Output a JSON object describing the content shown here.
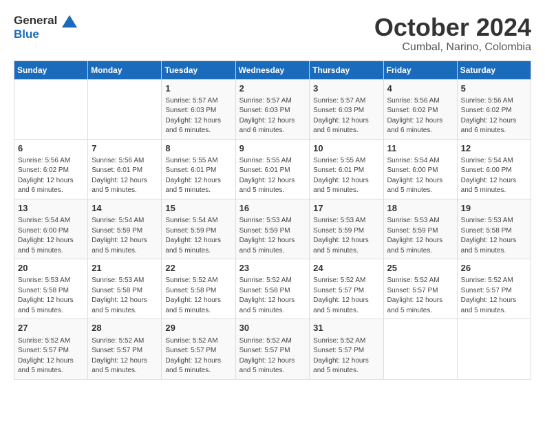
{
  "logo": {
    "line1": "General",
    "line2": "Blue"
  },
  "title": "October 2024",
  "subtitle": "Cumbal, Narino, Colombia",
  "headers": [
    "Sunday",
    "Monday",
    "Tuesday",
    "Wednesday",
    "Thursday",
    "Friday",
    "Saturday"
  ],
  "weeks": [
    [
      {
        "day": "",
        "sunrise": "",
        "sunset": "",
        "daylight": ""
      },
      {
        "day": "",
        "sunrise": "",
        "sunset": "",
        "daylight": ""
      },
      {
        "day": "1",
        "sunrise": "Sunrise: 5:57 AM",
        "sunset": "Sunset: 6:03 PM",
        "daylight": "Daylight: 12 hours and 6 minutes."
      },
      {
        "day": "2",
        "sunrise": "Sunrise: 5:57 AM",
        "sunset": "Sunset: 6:03 PM",
        "daylight": "Daylight: 12 hours and 6 minutes."
      },
      {
        "day": "3",
        "sunrise": "Sunrise: 5:57 AM",
        "sunset": "Sunset: 6:03 PM",
        "daylight": "Daylight: 12 hours and 6 minutes."
      },
      {
        "day": "4",
        "sunrise": "Sunrise: 5:56 AM",
        "sunset": "Sunset: 6:02 PM",
        "daylight": "Daylight: 12 hours and 6 minutes."
      },
      {
        "day": "5",
        "sunrise": "Sunrise: 5:56 AM",
        "sunset": "Sunset: 6:02 PM",
        "daylight": "Daylight: 12 hours and 6 minutes."
      }
    ],
    [
      {
        "day": "6",
        "sunrise": "Sunrise: 5:56 AM",
        "sunset": "Sunset: 6:02 PM",
        "daylight": "Daylight: 12 hours and 6 minutes."
      },
      {
        "day": "7",
        "sunrise": "Sunrise: 5:56 AM",
        "sunset": "Sunset: 6:01 PM",
        "daylight": "Daylight: 12 hours and 5 minutes."
      },
      {
        "day": "8",
        "sunrise": "Sunrise: 5:55 AM",
        "sunset": "Sunset: 6:01 PM",
        "daylight": "Daylight: 12 hours and 5 minutes."
      },
      {
        "day": "9",
        "sunrise": "Sunrise: 5:55 AM",
        "sunset": "Sunset: 6:01 PM",
        "daylight": "Daylight: 12 hours and 5 minutes."
      },
      {
        "day": "10",
        "sunrise": "Sunrise: 5:55 AM",
        "sunset": "Sunset: 6:01 PM",
        "daylight": "Daylight: 12 hours and 5 minutes."
      },
      {
        "day": "11",
        "sunrise": "Sunrise: 5:54 AM",
        "sunset": "Sunset: 6:00 PM",
        "daylight": "Daylight: 12 hours and 5 minutes."
      },
      {
        "day": "12",
        "sunrise": "Sunrise: 5:54 AM",
        "sunset": "Sunset: 6:00 PM",
        "daylight": "Daylight: 12 hours and 5 minutes."
      }
    ],
    [
      {
        "day": "13",
        "sunrise": "Sunrise: 5:54 AM",
        "sunset": "Sunset: 6:00 PM",
        "daylight": "Daylight: 12 hours and 5 minutes."
      },
      {
        "day": "14",
        "sunrise": "Sunrise: 5:54 AM",
        "sunset": "Sunset: 5:59 PM",
        "daylight": "Daylight: 12 hours and 5 minutes."
      },
      {
        "day": "15",
        "sunrise": "Sunrise: 5:54 AM",
        "sunset": "Sunset: 5:59 PM",
        "daylight": "Daylight: 12 hours and 5 minutes."
      },
      {
        "day": "16",
        "sunrise": "Sunrise: 5:53 AM",
        "sunset": "Sunset: 5:59 PM",
        "daylight": "Daylight: 12 hours and 5 minutes."
      },
      {
        "day": "17",
        "sunrise": "Sunrise: 5:53 AM",
        "sunset": "Sunset: 5:59 PM",
        "daylight": "Daylight: 12 hours and 5 minutes."
      },
      {
        "day": "18",
        "sunrise": "Sunrise: 5:53 AM",
        "sunset": "Sunset: 5:59 PM",
        "daylight": "Daylight: 12 hours and 5 minutes."
      },
      {
        "day": "19",
        "sunrise": "Sunrise: 5:53 AM",
        "sunset": "Sunset: 5:58 PM",
        "daylight": "Daylight: 12 hours and 5 minutes."
      }
    ],
    [
      {
        "day": "20",
        "sunrise": "Sunrise: 5:53 AM",
        "sunset": "Sunset: 5:58 PM",
        "daylight": "Daylight: 12 hours and 5 minutes."
      },
      {
        "day": "21",
        "sunrise": "Sunrise: 5:53 AM",
        "sunset": "Sunset: 5:58 PM",
        "daylight": "Daylight: 12 hours and 5 minutes."
      },
      {
        "day": "22",
        "sunrise": "Sunrise: 5:52 AM",
        "sunset": "Sunset: 5:58 PM",
        "daylight": "Daylight: 12 hours and 5 minutes."
      },
      {
        "day": "23",
        "sunrise": "Sunrise: 5:52 AM",
        "sunset": "Sunset: 5:58 PM",
        "daylight": "Daylight: 12 hours and 5 minutes."
      },
      {
        "day": "24",
        "sunrise": "Sunrise: 5:52 AM",
        "sunset": "Sunset: 5:57 PM",
        "daylight": "Daylight: 12 hours and 5 minutes."
      },
      {
        "day": "25",
        "sunrise": "Sunrise: 5:52 AM",
        "sunset": "Sunset: 5:57 PM",
        "daylight": "Daylight: 12 hours and 5 minutes."
      },
      {
        "day": "26",
        "sunrise": "Sunrise: 5:52 AM",
        "sunset": "Sunset: 5:57 PM",
        "daylight": "Daylight: 12 hours and 5 minutes."
      }
    ],
    [
      {
        "day": "27",
        "sunrise": "Sunrise: 5:52 AM",
        "sunset": "Sunset: 5:57 PM",
        "daylight": "Daylight: 12 hours and 5 minutes."
      },
      {
        "day": "28",
        "sunrise": "Sunrise: 5:52 AM",
        "sunset": "Sunset: 5:57 PM",
        "daylight": "Daylight: 12 hours and 5 minutes."
      },
      {
        "day": "29",
        "sunrise": "Sunrise: 5:52 AM",
        "sunset": "Sunset: 5:57 PM",
        "daylight": "Daylight: 12 hours and 5 minutes."
      },
      {
        "day": "30",
        "sunrise": "Sunrise: 5:52 AM",
        "sunset": "Sunset: 5:57 PM",
        "daylight": "Daylight: 12 hours and 5 minutes."
      },
      {
        "day": "31",
        "sunrise": "Sunrise: 5:52 AM",
        "sunset": "Sunset: 5:57 PM",
        "daylight": "Daylight: 12 hours and 5 minutes."
      },
      {
        "day": "",
        "sunrise": "",
        "sunset": "",
        "daylight": ""
      },
      {
        "day": "",
        "sunrise": "",
        "sunset": "",
        "daylight": ""
      }
    ]
  ]
}
